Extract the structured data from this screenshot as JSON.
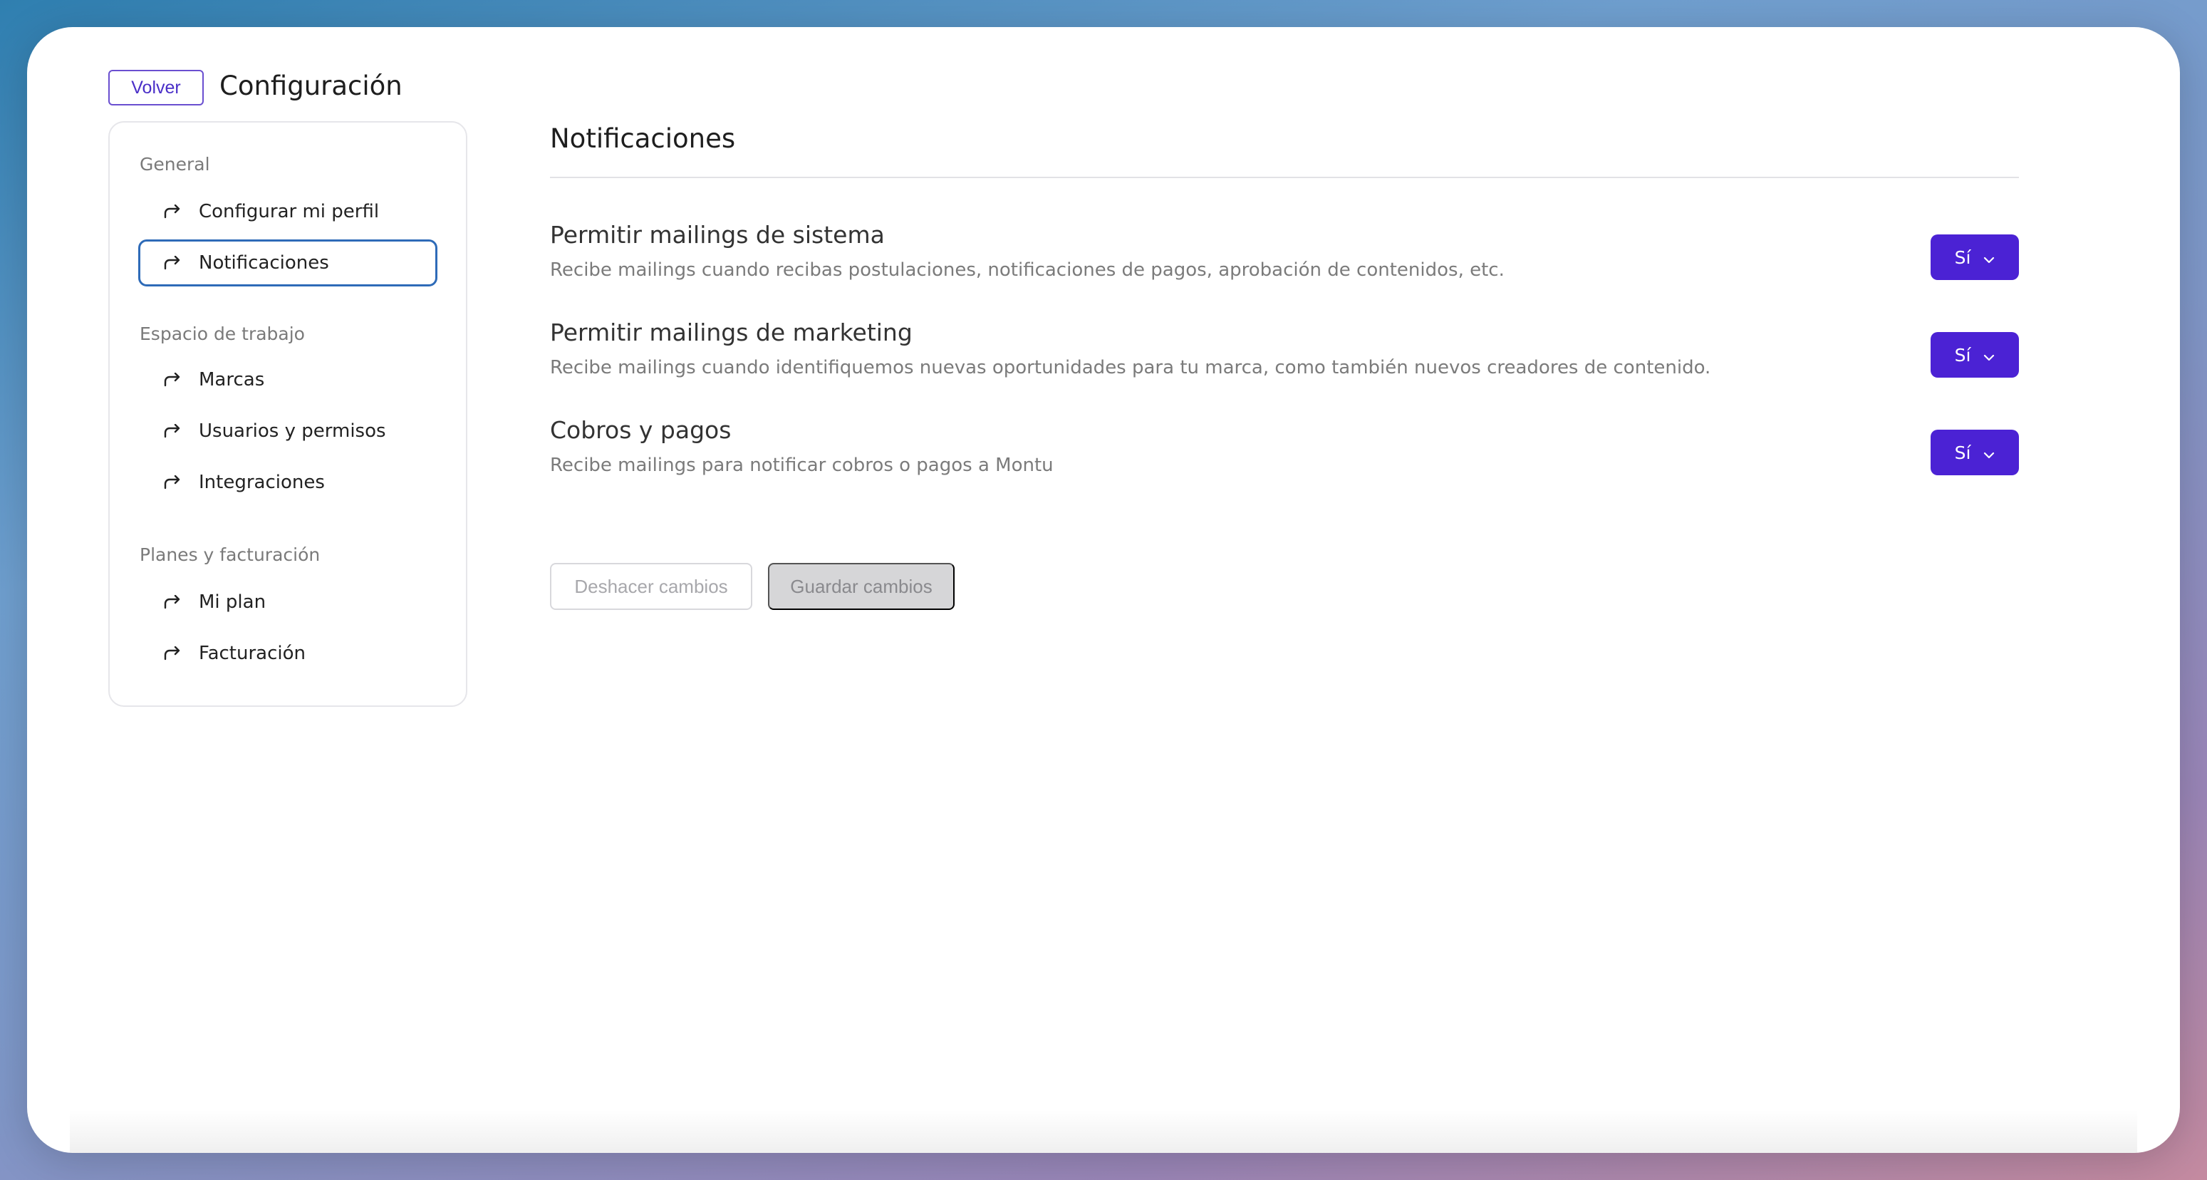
{
  "header": {
    "back_label": "Volver",
    "title": "Configuración"
  },
  "sidebar": {
    "sections": [
      {
        "heading": "General",
        "items": [
          {
            "label": "Configurar mi perfil",
            "icon": "redirect-arrow-icon",
            "active": false
          },
          {
            "label": "Notificaciones",
            "icon": "redirect-arrow-icon",
            "active": true
          }
        ]
      },
      {
        "heading": "Espacio de trabajo",
        "items": [
          {
            "label": "Marcas",
            "icon": "redirect-arrow-icon",
            "active": false
          },
          {
            "label": "Usuarios y permisos",
            "icon": "redirect-arrow-icon",
            "active": false
          },
          {
            "label": "Integraciones",
            "icon": "redirect-arrow-icon",
            "active": false
          }
        ]
      },
      {
        "heading": "Planes y facturación",
        "items": [
          {
            "label": "Mi plan",
            "icon": "redirect-arrow-icon",
            "active": false
          },
          {
            "label": "Facturación",
            "icon": "redirect-arrow-icon",
            "active": false
          }
        ]
      }
    ]
  },
  "main": {
    "heading": "Notificaciones",
    "settings": [
      {
        "title": "Permitir mailings de sistema",
        "description": "Recibe mailings cuando recibas postulaciones, notificaciones de pagos, aprobación de contenidos, etc.",
        "value": "Sí"
      },
      {
        "title": "Permitir mailings de marketing",
        "description": "Recibe mailings cuando identifiquemos nuevas oportunidades para tu marca, como también nuevos creadores de contenido.",
        "value": "Sí"
      },
      {
        "title": "Cobros y pagos",
        "description": "Recibe mailings para notificar cobros o pagos a Montu",
        "value": "Sí"
      }
    ],
    "actions": {
      "undo_label": "Deshacer cambios",
      "save_label": "Guardar cambios"
    }
  },
  "colors": {
    "accent": "#4b22d4",
    "active_border": "#2e6bb8",
    "back_button": "#6a4fd0"
  }
}
